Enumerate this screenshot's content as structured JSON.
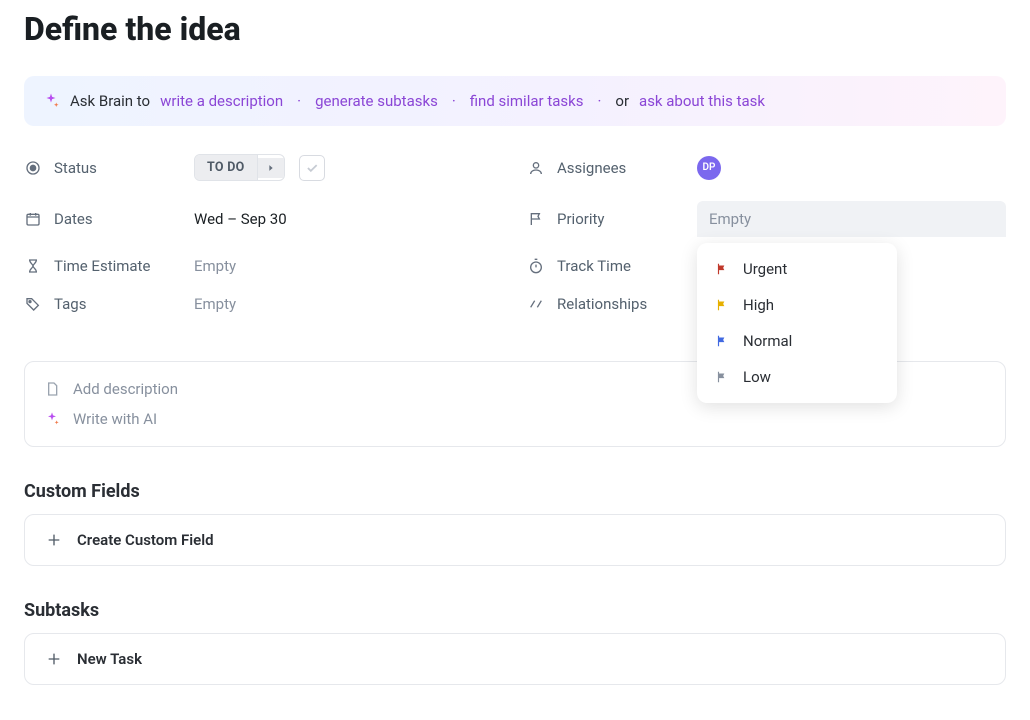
{
  "title": "Define the idea",
  "ai_banner": {
    "prefix": "Ask Brain to",
    "write_description": "write a description",
    "generate_subtasks": "generate subtasks",
    "find_similar": "find similar tasks",
    "or": "or",
    "ask_about": "ask about this task"
  },
  "fields": {
    "status": {
      "label": "Status",
      "value": "TO DO"
    },
    "dates": {
      "label": "Dates",
      "value": "Wed – Sep 30"
    },
    "time_estimate": {
      "label": "Time Estimate",
      "value": "Empty"
    },
    "tags": {
      "label": "Tags",
      "value": "Empty"
    },
    "assignees": {
      "label": "Assignees",
      "initials": "DP"
    },
    "priority": {
      "label": "Priority",
      "placeholder": "Empty"
    },
    "track_time": {
      "label": "Track Time"
    },
    "relationships": {
      "label": "Relationships"
    }
  },
  "priority_options": [
    {
      "label": "Urgent",
      "color": "red"
    },
    {
      "label": "High",
      "color": "orange"
    },
    {
      "label": "Normal",
      "color": "blue"
    },
    {
      "label": "Low",
      "color": "gray"
    }
  ],
  "description": {
    "add": "Add description",
    "write_ai": "Write with AI"
  },
  "sections": {
    "custom_fields": {
      "heading": "Custom Fields",
      "button": "Create Custom Field"
    },
    "subtasks": {
      "heading": "Subtasks",
      "button": "New Task"
    }
  }
}
